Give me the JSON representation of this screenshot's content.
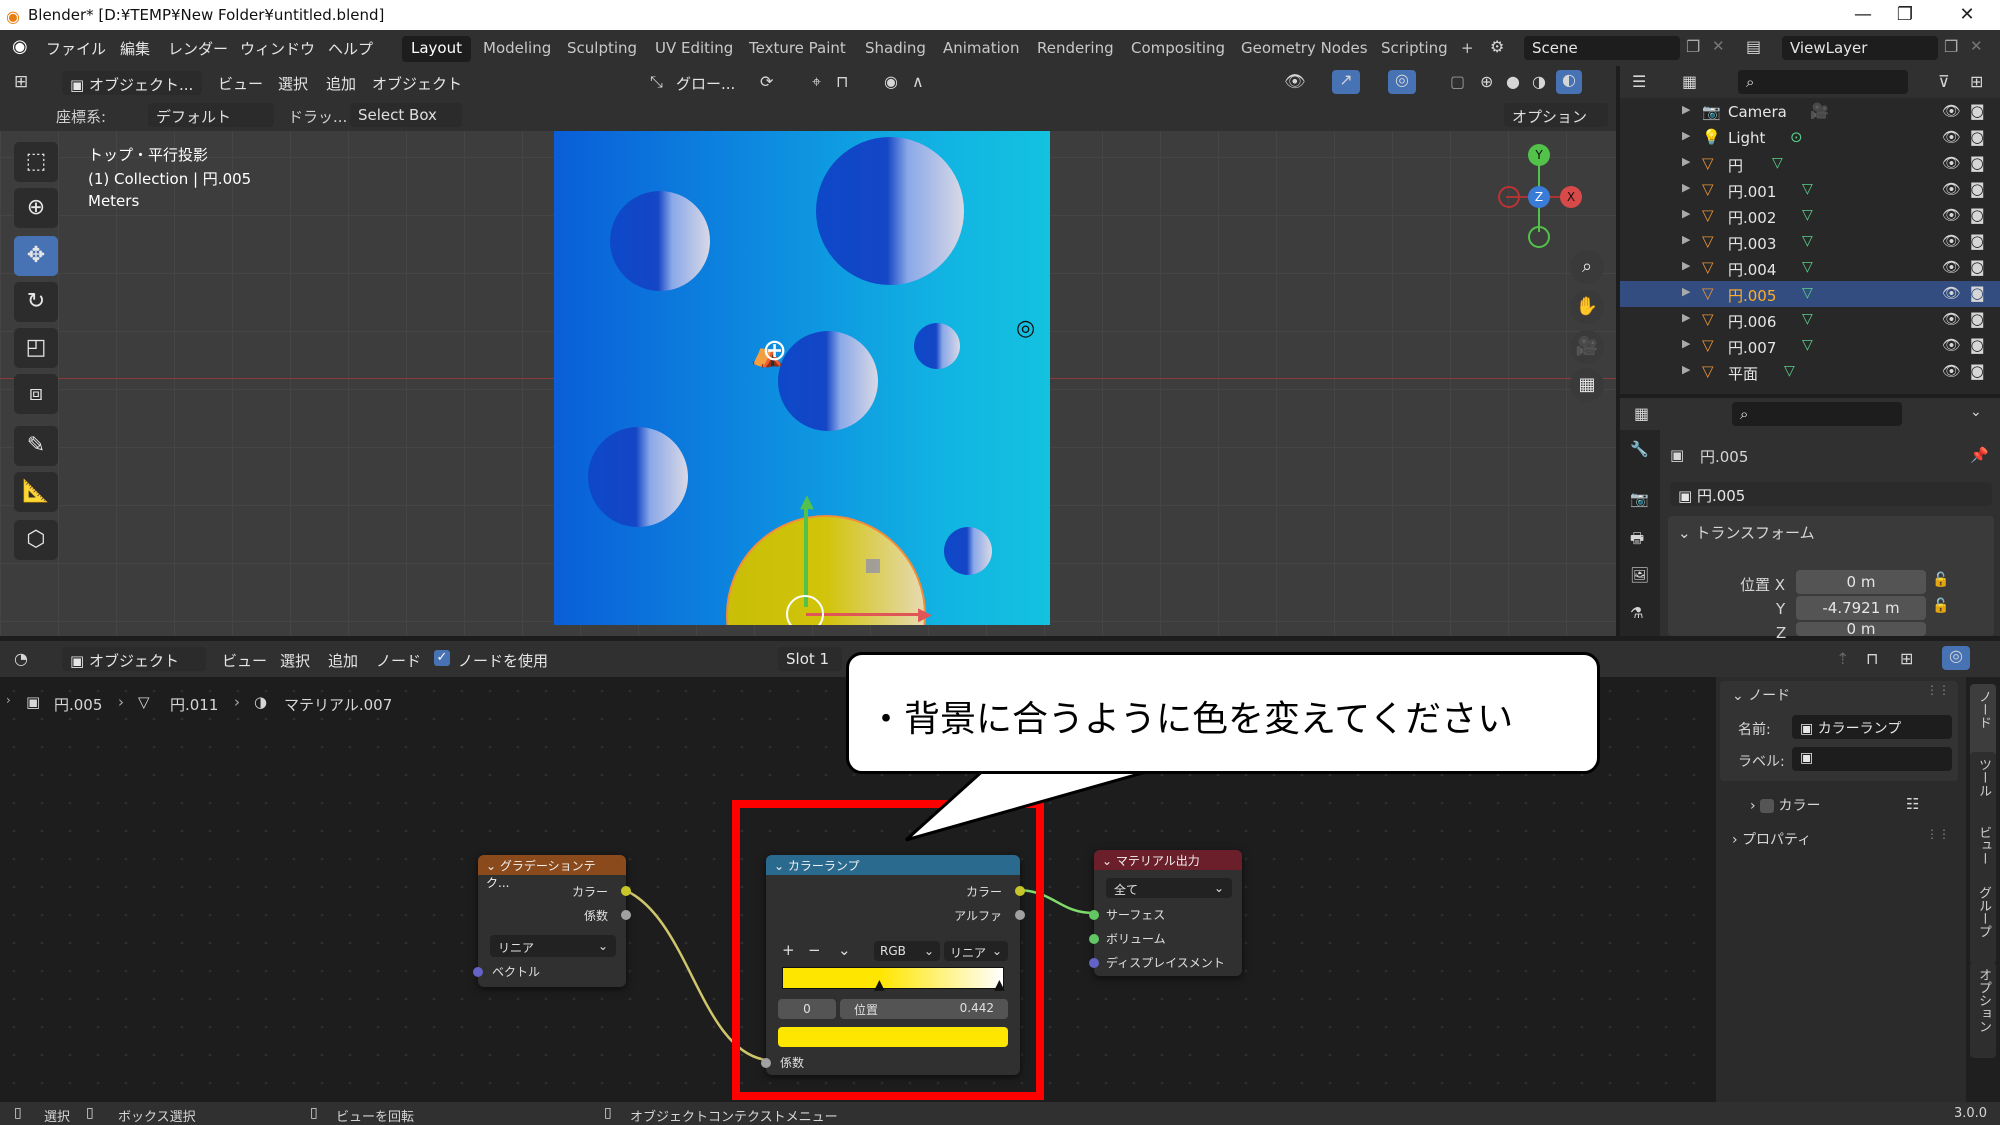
{
  "titlebar": {
    "title": "Blender* [D:¥TEMP¥New Folder¥untitled.blend]",
    "minimize": "—",
    "restore": "❐",
    "close": "✕"
  },
  "topmenu": {
    "items": [
      "ファイル",
      "編集",
      "レンダー",
      "ウィンドウ",
      "ヘルプ"
    ],
    "workspaces": [
      "Layout",
      "Modeling",
      "Sculpting",
      "UV Editing",
      "Texture Paint",
      "Shading",
      "Animation",
      "Rendering",
      "Compositing",
      "Geometry Nodes",
      "Scripting"
    ],
    "add_workspace": "+",
    "scene": "Scene",
    "view_layer": "ViewLayer"
  },
  "viewport": {
    "mode": "オブジェクト...",
    "menus": [
      "ビュー",
      "選択",
      "追加",
      "オブジェクト"
    ],
    "transform_orientation": "グロー...",
    "coord_label": "座標系:",
    "coord_value": "デフォルト",
    "drag_label": "ドラッ...",
    "drag_value": "Select Box",
    "options": "オプション",
    "info_line1": "トップ・平行投影",
    "info_line2": "(1) Collection | 円.005",
    "info_line3": "Meters",
    "gizmo": {
      "y": "Y",
      "z": "Z",
      "x": "X"
    }
  },
  "outliner": {
    "items": [
      {
        "name": "Camera",
        "icon": "camera-icon"
      },
      {
        "name": "Light",
        "icon": "light-icon"
      },
      {
        "name": "円",
        "icon": "mesh-icon"
      },
      {
        "name": "円.001",
        "icon": "mesh-icon"
      },
      {
        "name": "円.002",
        "icon": "mesh-icon"
      },
      {
        "name": "円.003",
        "icon": "mesh-icon"
      },
      {
        "name": "円.004",
        "icon": "mesh-icon"
      },
      {
        "name": "円.005",
        "icon": "mesh-icon",
        "selected": true
      },
      {
        "name": "円.006",
        "icon": "mesh-icon"
      },
      {
        "name": "円.007",
        "icon": "mesh-icon"
      },
      {
        "name": "平面",
        "icon": "mesh-icon"
      }
    ]
  },
  "properties": {
    "object_name": "円.005",
    "data_name": "円.005",
    "section": "トランスフォーム",
    "loc_label": "位置 X",
    "loc_x": "0 m",
    "y_label": "Y",
    "loc_y": "-4.7921 m",
    "z_label": "Z",
    "loc_z": "0 m"
  },
  "node_editor": {
    "mode": "オブジェクト",
    "menus": [
      "ビュー",
      "選択",
      "追加",
      "ノード"
    ],
    "use_nodes_label": "ノードを使用",
    "slot": "Slot 1",
    "breadcrumb": [
      "円.005",
      "円.011",
      "マテリアル.007"
    ],
    "gradient_node": {
      "title": "グラデーションテク...",
      "out_color": "カラー",
      "out_fac": "係数",
      "type": "リニア",
      "in_vector": "ベクトル"
    },
    "colorramp_node": {
      "title": "カラーランプ",
      "out_color": "カラー",
      "out_alpha": "アルファ",
      "add": "+",
      "remove": "−",
      "menu": "⌄",
      "color_mode": "RGB",
      "interp": "リニア",
      "index": "0",
      "pos_label": "位置",
      "pos_value": "0.442",
      "in_fac": "係数",
      "stop_color": "#ffe600"
    },
    "output_node": {
      "title": "マテリアル出力",
      "target": "全て",
      "surface": "サーフェス",
      "volume": "ボリューム",
      "displacement": "ディスプレイスメント"
    }
  },
  "n_panel": {
    "section": "ノード",
    "name_label": "名前:",
    "name_value": "カラーランプ",
    "label_label": "ラベル:",
    "color_label": "カラー",
    "properties_label": "プロパティ",
    "tabs": [
      "ノード",
      "ツール",
      "ビュー",
      "グループ",
      "オプション"
    ]
  },
  "status_bar": {
    "select": "選択",
    "box_select": "ボックス選択",
    "rotate_view": "ビューを回転",
    "context_menu": "オブジェクトコンテクストメニュー",
    "version": "3.0.0"
  },
  "callout": {
    "text": "・背景に合うように色を変えてください"
  }
}
